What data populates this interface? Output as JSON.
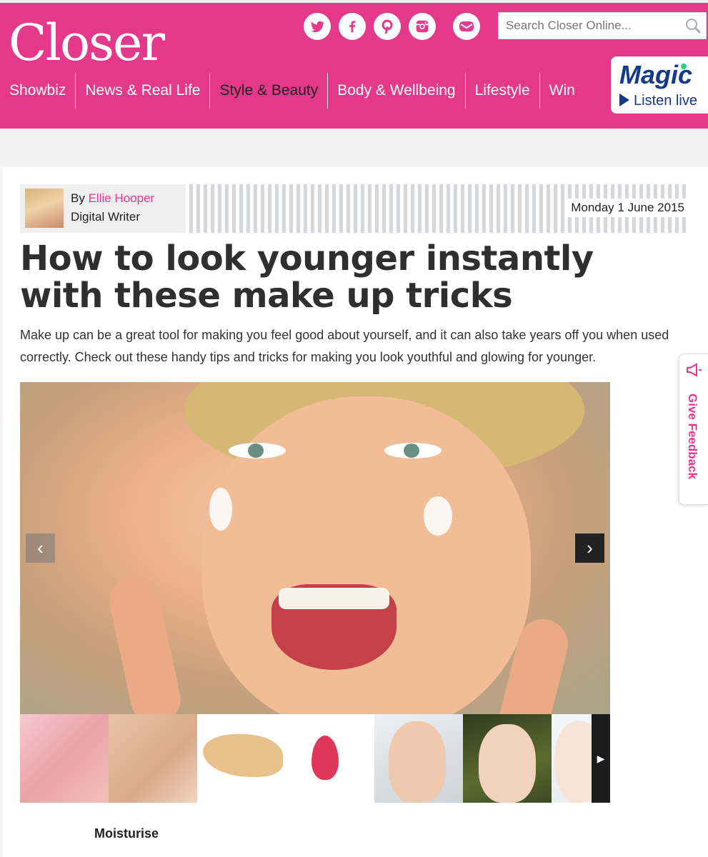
{
  "brand": {
    "logo": "Closer",
    "accent": "#e4398b"
  },
  "header": {
    "social": [
      {
        "name": "twitter-icon",
        "glyph": "t"
      },
      {
        "name": "facebook-icon",
        "glyph": "f"
      },
      {
        "name": "pinterest-icon",
        "glyph": "p"
      },
      {
        "name": "instagram-icon",
        "glyph": "◘"
      },
      {
        "name": "email-icon",
        "glyph": "✉"
      }
    ],
    "search": {
      "placeholder": "Search Closer Online..."
    },
    "nav": [
      "Showbiz",
      "News & Real Life",
      "Style & Beauty",
      "Body & Wellbeing",
      "Lifestyle",
      "Win"
    ],
    "nav_active": "Style & Beauty",
    "radio": {
      "name": "Magic",
      "cta": "Listen live"
    }
  },
  "article": {
    "author": {
      "by": "By",
      "name": "Ellie Hooper",
      "role": "Digital Writer"
    },
    "date": "Monday 1 June 2015",
    "title": "How to look younger instantly with these make up tricks",
    "intro": "Make up can be a great tool for making you feel good about yourself, and it can also take years off you when used correctly. Check out these handy tips and tricks for making you look youthful and glowing for younger.",
    "gallery": {
      "prev": "‹",
      "next": "›",
      "thumb_next": "▶",
      "caption": "Moisturise"
    }
  },
  "feedback": {
    "label": "Give Feedback"
  }
}
